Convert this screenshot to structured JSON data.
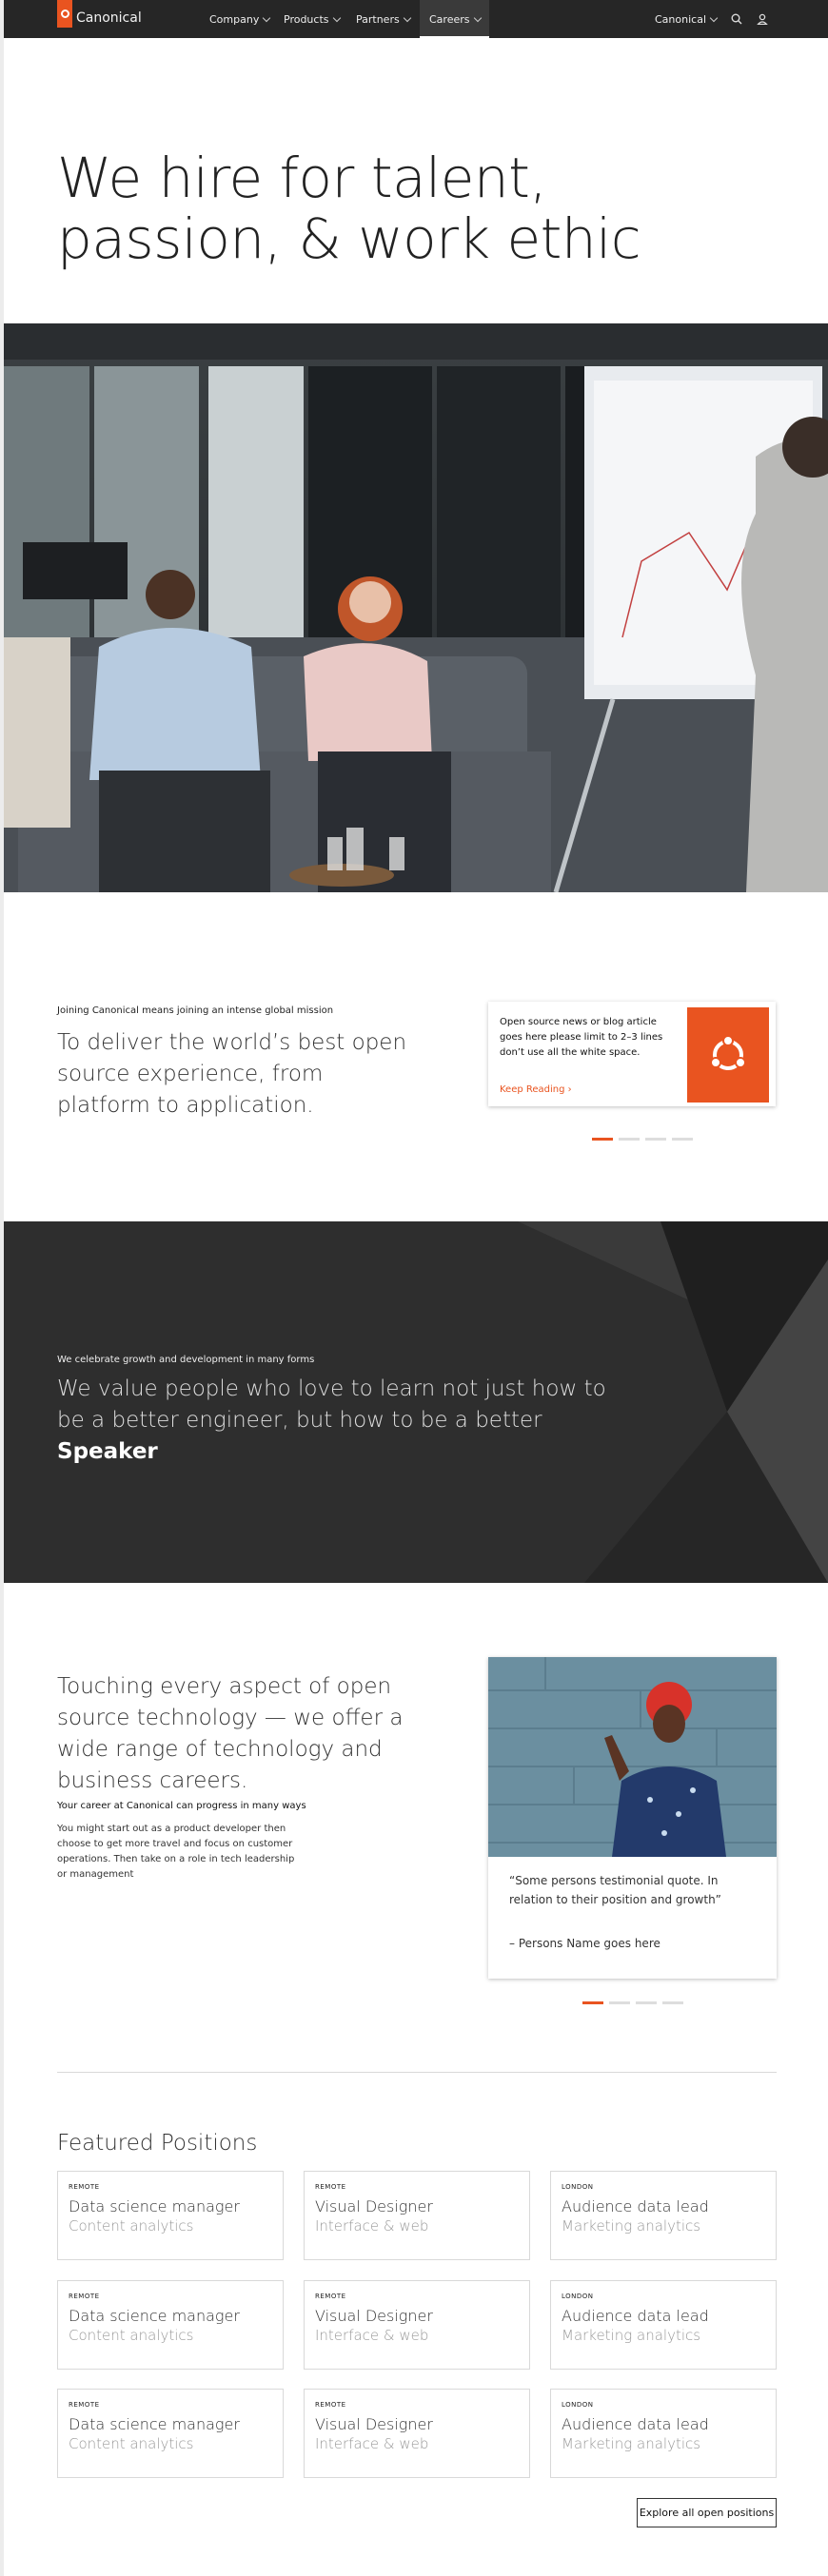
{
  "header": {
    "logo_text": "Canonical",
    "nav": [
      "Company",
      "Products",
      "Partners",
      "Careers"
    ],
    "right_nav": "Canonical",
    "icons": [
      "search-icon",
      "user-icon"
    ],
    "accent": "#e95420"
  },
  "hero": {
    "title_line1": "We hire for talent,",
    "title_line2": "passion, & work ethic"
  },
  "intro": {
    "kicker": "Joining Canonical means joining an intense global mission",
    "text": "To deliver the world’s best open source experience, from platform to application.",
    "card": {
      "text": "Open source news or blog article goes here please limit to 2–3 lines don’t use all the white space.",
      "link": "Keep Reading ›"
    }
  },
  "growth": {
    "kicker": "We celebrate growth and development in many forms",
    "text": "We value people who love to learn not just how to be a better engineer, but how to be a better",
    "highlight": "Speaker"
  },
  "careers": {
    "title": "Touching every aspect of open source technology — we offer a wide range of technology and business careers.",
    "kicker": "Your career at Canonical can progress in many ways",
    "body": "You might start out as a product developer then choose to get more travel and focus on customer operations. Then take on a role in tech leadership or management",
    "quote": "“Some persons testimonial quote. In relation to their position and growth”",
    "quote_name": "– Persons Name goes here"
  },
  "featured": {
    "title": "Featured Positions",
    "jobs": [
      {
        "location": "REMOTE",
        "role": "Data science manager",
        "team": "Content analytics"
      },
      {
        "location": "REMOTE",
        "role": "Visual Designer",
        "team": "Interface & web"
      },
      {
        "location": "LONDON",
        "role": "Audience data lead",
        "team": "Marketing analytics"
      },
      {
        "location": "REMOTE",
        "role": "Data science manager",
        "team": "Content analytics"
      },
      {
        "location": "REMOTE",
        "role": "Visual Designer",
        "team": "Interface & web"
      },
      {
        "location": "LONDON",
        "role": "Audience data lead",
        "team": "Marketing analytics"
      },
      {
        "location": "REMOTE",
        "role": "Data science manager",
        "team": "Content analytics"
      },
      {
        "location": "REMOTE",
        "role": "Visual Designer",
        "team": "Interface & web"
      },
      {
        "location": "LONDON",
        "role": "Audience data lead",
        "team": "Marketing analytics"
      }
    ],
    "explore_label": "Explore all open positions"
  }
}
